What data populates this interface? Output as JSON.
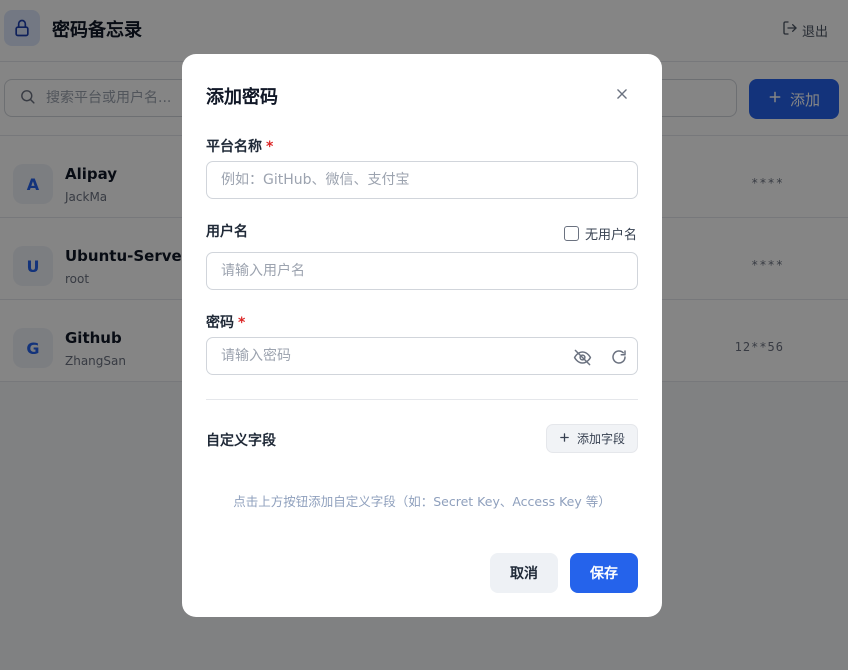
{
  "header": {
    "title": "密码备忘录",
    "logout_label": "退出"
  },
  "toolbar": {
    "search_placeholder": "搜索平台或用户名...",
    "add_label": "添加"
  },
  "entries": [
    {
      "initial": "A",
      "name": "Alipay",
      "username": "JackMa",
      "password": "****"
    },
    {
      "initial": "U",
      "name": "Ubuntu-Server",
      "username": "root",
      "password": "****"
    },
    {
      "initial": "G",
      "name": "Github",
      "username": "ZhangSan",
      "password": "12**56"
    }
  ],
  "modal": {
    "title": "添加密码",
    "platform": {
      "label": "平台名称",
      "required_mark": "*",
      "placeholder": "例如：GitHub、微信、支付宝",
      "value": ""
    },
    "username": {
      "label": "用户名",
      "placeholder": "请输入用户名",
      "value": "",
      "no_username_label": "无用户名",
      "no_username_checked": false
    },
    "password": {
      "label": "密码",
      "required_mark": "*",
      "placeholder": "请输入密码",
      "value": ""
    },
    "custom_fields": {
      "label": "自定义字段",
      "add_label": "添加字段",
      "hint": "点击上方按钮添加自定义字段（如：Secret Key、Access Key 等）"
    },
    "cancel_label": "取消",
    "save_label": "保存"
  },
  "colors": {
    "accent": "#2563eb",
    "required": "#dc2626",
    "overlay": "rgba(0,0,0,0.48)"
  },
  "icons": [
    "lock-icon",
    "logout-icon",
    "search-icon",
    "plus-icon",
    "close-icon",
    "eye-off-icon",
    "refresh-icon"
  ]
}
